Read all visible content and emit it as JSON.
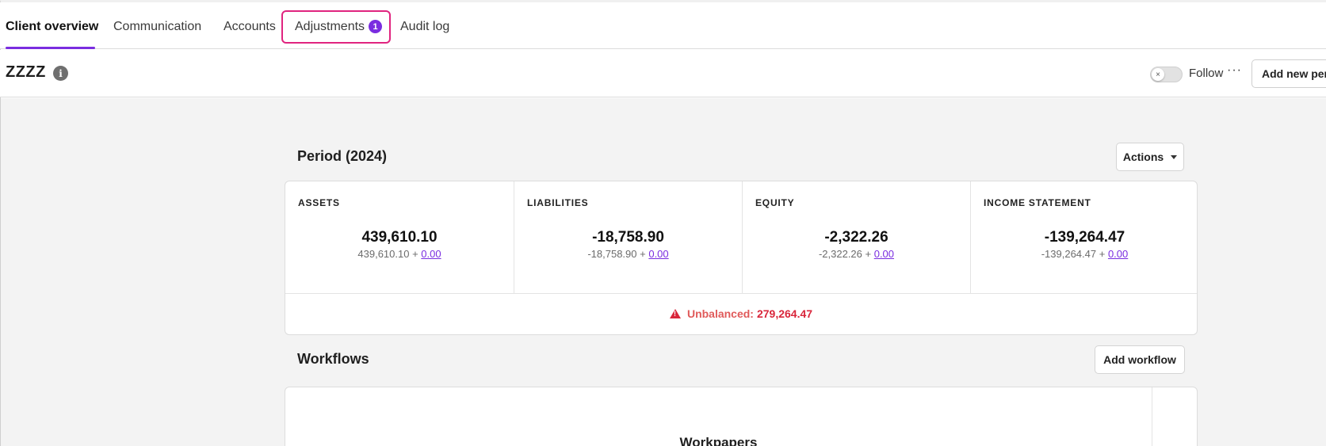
{
  "tabs": [
    {
      "label": "Client overview",
      "active": true
    },
    {
      "label": "Communication"
    },
    {
      "label": "Accounts"
    },
    {
      "label": "Adjustments",
      "badge": "1",
      "highlighted": true
    },
    {
      "label": "Audit log"
    }
  ],
  "header": {
    "client_name": "ZZZZ",
    "info_icon": "info-icon",
    "follow_label": "Follow",
    "follow_toggle": {
      "checked": false
    },
    "more_icon": "···",
    "add_period_label": "Add new period"
  },
  "period": {
    "title": "Period (2024)",
    "actions_label": "Actions",
    "columns": [
      {
        "label": "ASSETS",
        "total": "439,610.10",
        "base": "439,610.10 +",
        "adjustment": "0.00"
      },
      {
        "label": "LIABILITIES",
        "total": "-18,758.90",
        "base": "-18,758.90 +",
        "adjustment": "0.00"
      },
      {
        "label": "EQUITY",
        "total": "-2,322.26",
        "base": "-2,322.26 +",
        "adjustment": "0.00"
      },
      {
        "label": "INCOME STATEMENT",
        "total": "-139,264.47",
        "base": "-139,264.47 +",
        "adjustment": "0.00"
      }
    ],
    "unbalanced_label": "Unbalanced:",
    "unbalanced_value": "279,264.47"
  },
  "workflows": {
    "title": "Workflows",
    "add_label": "Add workflow",
    "workpapers_title": "Workpapers"
  },
  "colors": {
    "accent": "#7a2de0",
    "highlight": "#e0247f",
    "error": "#d9263b"
  }
}
